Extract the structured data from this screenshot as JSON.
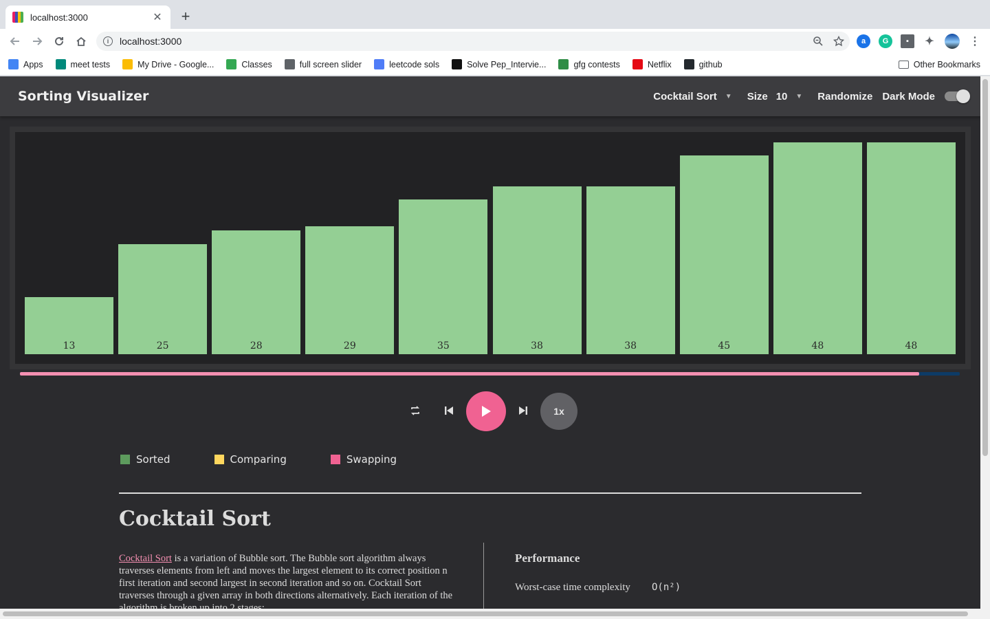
{
  "browser": {
    "tab_title": "localhost:3000",
    "tab_close": "✕",
    "new_tab": "+",
    "url": "localhost:3000",
    "bookmarks": [
      {
        "label": "Apps",
        "color": "#4285f4"
      },
      {
        "label": "meet tests",
        "color": "#00897b"
      },
      {
        "label": "My Drive - Google...",
        "color": "#fbbc04"
      },
      {
        "label": "Classes",
        "color": "#34a853"
      },
      {
        "label": "full screen slider",
        "color": "#5f6368"
      },
      {
        "label": "leetcode sols",
        "color": "#4f7cf7"
      },
      {
        "label": "Solve Pep_Intervie...",
        "color": "#111111"
      },
      {
        "label": "gfg contests",
        "color": "#2f8d46"
      },
      {
        "label": "Netflix",
        "color": "#e50914"
      },
      {
        "label": "github",
        "color": "#24292e"
      }
    ],
    "other_bookmarks": "Other Bookmarks"
  },
  "app": {
    "title": "Sorting Visualizer",
    "algorithm": "Cocktail Sort",
    "size_label": "Size",
    "size_value": "10",
    "randomize": "Randomize",
    "dark_mode": "Dark Mode",
    "dark_mode_on": true
  },
  "chart_data": {
    "type": "bar",
    "values": [
      13,
      25,
      28,
      29,
      35,
      38,
      38,
      45,
      48,
      48
    ],
    "bar_color": "#94cf94"
  },
  "progress": 0.957,
  "speed": "1x",
  "legend": [
    {
      "label": "Sorted",
      "color": "#5d9b5d"
    },
    {
      "label": "Comparing",
      "color": "#ffd75e"
    },
    {
      "label": "Swapping",
      "color": "#f06292"
    }
  ],
  "article": {
    "title": "Cocktail Sort",
    "link_text": "Cocktail Sort",
    "description": " is a variation of Bubble sort. The Bubble sort algorithm always traverses elements from left and moves the largest element to its correct position n first iteration and second largest in second iteration and so on. Cocktail Sort traverses through a given array in both directions alternatively. Each iteration of the algorithm is broken up into 2 stages:",
    "performance_title": "Performance",
    "rows": [
      {
        "label": "Worst-case time complexity",
        "value": "O(n²)"
      }
    ]
  }
}
